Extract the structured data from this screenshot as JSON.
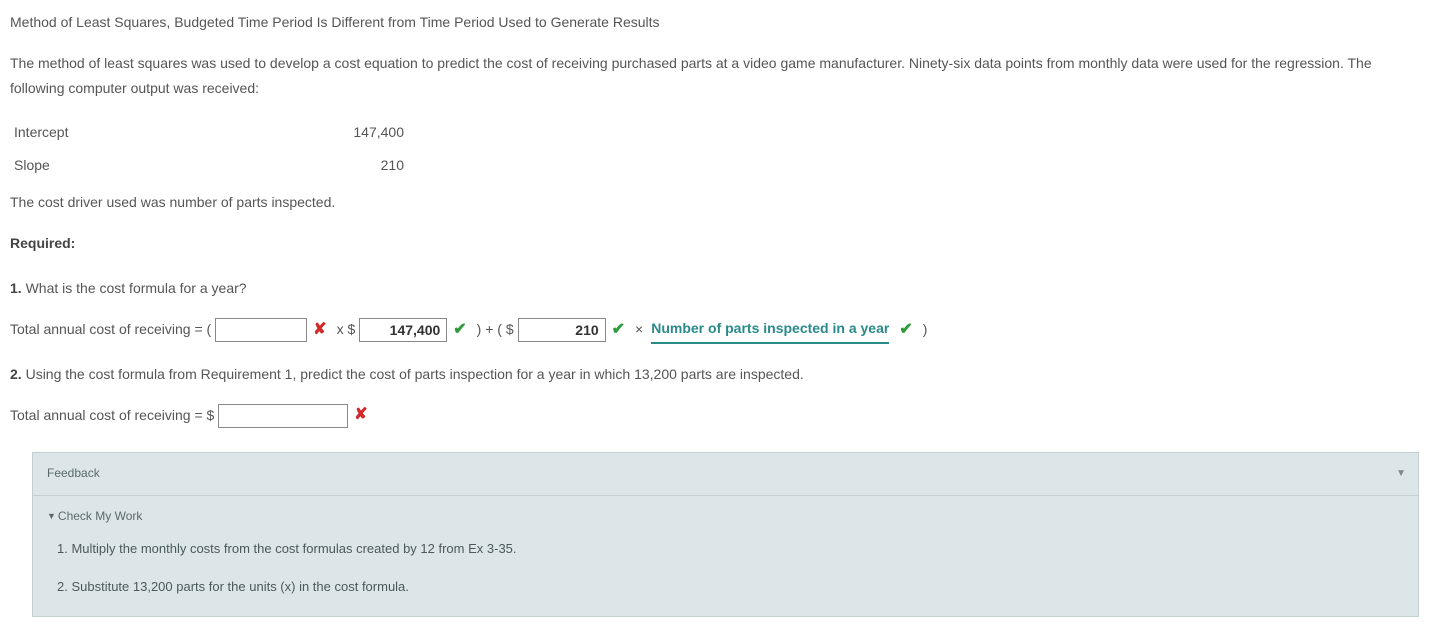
{
  "title": "Method of Least Squares, Budgeted Time Period Is Different from Time Period Used to Generate Results",
  "intro": "The method of least squares was used to develop a cost equation to predict the cost of receiving purchased parts at a video game manufacturer. Ninety-six data points from monthly data were used for the regression. The following computer output was received:",
  "rows": {
    "intercept_label": "Intercept",
    "intercept_value": "147,400",
    "slope_label": "Slope",
    "slope_value": "210"
  },
  "driver_note": "The cost driver used was number of parts inspected.",
  "required_label": "Required:",
  "q1": {
    "num": "1.",
    "text": "What is the cost formula for a year?",
    "lead": "Total annual cost of receiving = (",
    "blank1_value": "",
    "mark1": "✘",
    "seg_x_dollar": "x $",
    "blank2_value": "147,400",
    "mark2": "✔",
    "seg_close_plus": ") + ( $",
    "blank3_value": "210",
    "mark3": "✔",
    "seg_times": "×",
    "dropdown_text": "Number of parts inspected in a year",
    "mark4": "✔",
    "seg_close2": ")"
  },
  "q2": {
    "num": "2.",
    "text": "Using the cost formula from Requirement 1, predict the cost of parts inspection for a year in which 13,200 parts are inspected.",
    "lead": "Total annual cost of receiving = $",
    "blank_value": "",
    "mark": "✘"
  },
  "feedback": {
    "header": "Feedback",
    "caret": "▼",
    "check_label": "Check My Work",
    "line1": "1. Multiply the monthly costs from the cost formulas created by 12 from Ex 3-35.",
    "line2": "2. Substitute 13,200 parts for the units (x) in the cost formula."
  }
}
